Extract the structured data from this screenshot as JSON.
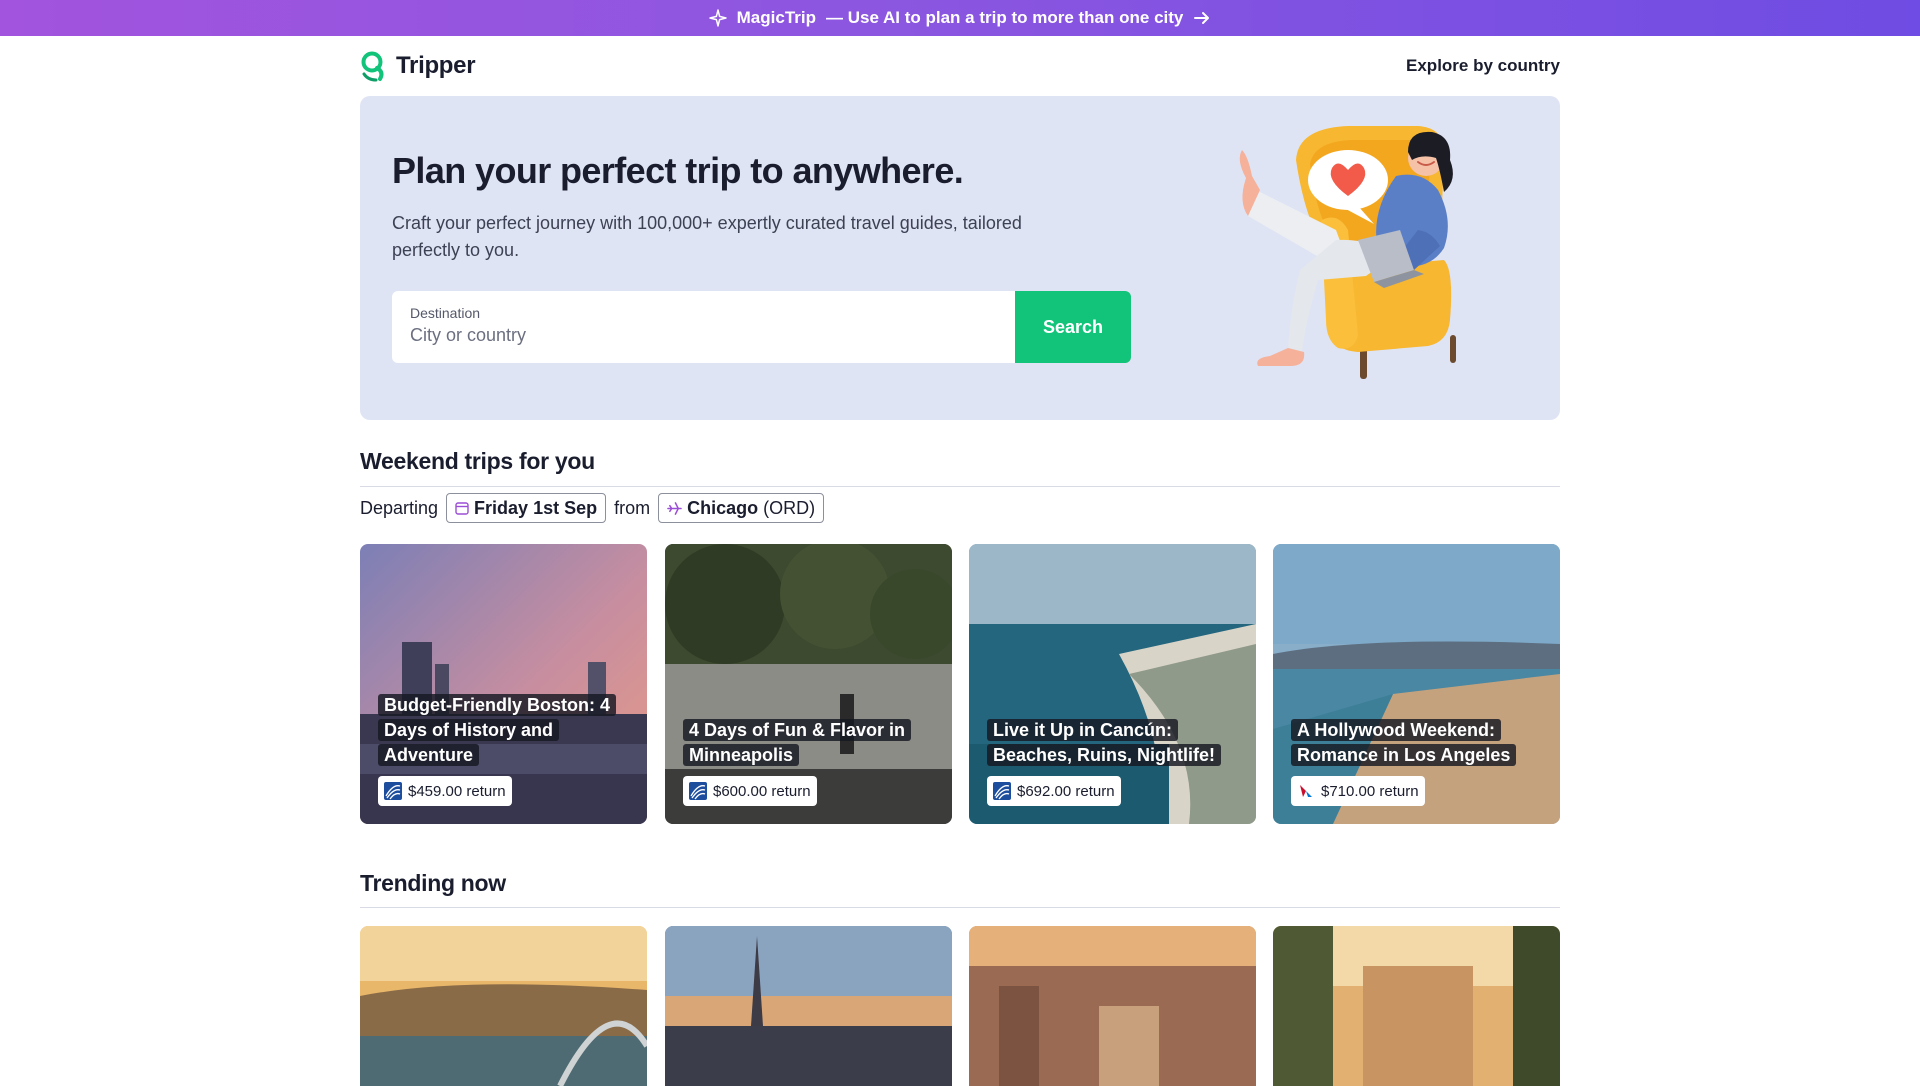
{
  "banner": {
    "brand": "MagicTrip",
    "text": "— Use AI to plan a trip to more than one city"
  },
  "header": {
    "logo_text": "Tripper",
    "explore_link": "Explore by country"
  },
  "hero": {
    "title": "Plan your perfect trip to anywhere.",
    "subtitle": "Craft your perfect journey with 100,000+ expertly curated travel guides, tailored perfectly to you.",
    "search": {
      "label": "Destination",
      "placeholder": "City or country",
      "button": "Search"
    }
  },
  "weekend": {
    "title": "Weekend trips for you",
    "departing_label": "Departing",
    "date": "Friday 1st Sep",
    "from_label": "from",
    "city": "Chicago",
    "airport": "(ORD)",
    "trips": [
      {
        "title": "Budget-Friendly Boston: 4 Days of History and Adventure",
        "price": "$459.00 return",
        "airline_icon": "united-airlines-icon"
      },
      {
        "title": "4 Days of Fun & Flavor in Minneapolis",
        "price": "$600.00 return",
        "airline_icon": "united-airlines-icon"
      },
      {
        "title": "Live it Up in Cancún: Beaches, Ruins, Nightlife!",
        "price": "$692.00 return",
        "airline_icon": "united-airlines-icon"
      },
      {
        "title": "A Hollywood Weekend: Romance in Los Angeles",
        "price": "$710.00 return",
        "airline_icon": "american-airlines-icon"
      }
    ]
  },
  "trending": {
    "title": "Trending now"
  },
  "colors": {
    "banner_start": "#a254de",
    "banner_end": "#6f4ce3",
    "accent_green": "#12c37a",
    "hero_bg": "#dfe4f4",
    "chip_icon": "#9b4fd6"
  }
}
